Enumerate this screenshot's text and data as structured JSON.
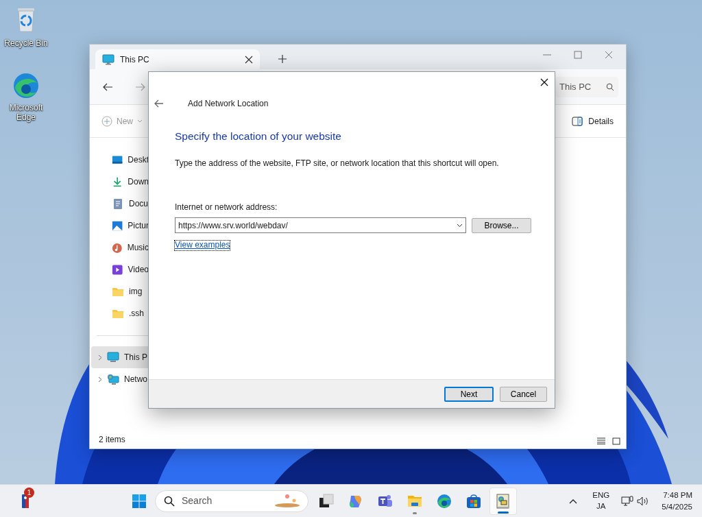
{
  "desktop_icons": [
    {
      "kind": "recycle",
      "label": "Recycle Bin"
    },
    {
      "kind": "edge",
      "label": "Microsoft Edge"
    }
  ],
  "explorer": {
    "tab_title": "This PC",
    "search_text": "This PC",
    "new_label": "New",
    "details_label": "Details",
    "quick_access": [
      {
        "kind": "desktop",
        "label": "Deskt"
      },
      {
        "kind": "download",
        "label": "Down"
      },
      {
        "kind": "documents",
        "label": "Docu"
      },
      {
        "kind": "pictures",
        "label": "Pictur"
      },
      {
        "kind": "music",
        "label": "Music"
      },
      {
        "kind": "videos",
        "label": "Video"
      },
      {
        "kind": "folder",
        "label": "img"
      },
      {
        "kind": "folder",
        "label": ".ssh"
      }
    ],
    "tree": [
      {
        "kind": "pc",
        "label": "This P",
        "selected": true
      },
      {
        "kind": "network",
        "label": "Netwo",
        "selected": false
      }
    ],
    "status": "2 items"
  },
  "dialog": {
    "title": "Add Network Location",
    "heading": "Specify the location of your website",
    "description": "Type the address of the website, FTP site, or network location that this shortcut will open.",
    "field_label": "Internet or network address:",
    "address": "https://www.srv.world/webdav/",
    "browse": "Browse...",
    "link": "View examples",
    "buttons": [
      {
        "label": "Next",
        "default": true
      },
      {
        "label": "Cancel",
        "default": false
      }
    ]
  },
  "taskbar": {
    "widget_badge": "1",
    "search_placeholder": "Search",
    "apps": [
      {
        "kind": "taskview",
        "running": false,
        "selected": false
      },
      {
        "kind": "copilot",
        "running": false,
        "selected": false
      },
      {
        "kind": "teams",
        "running": false,
        "selected": false
      },
      {
        "kind": "files",
        "running": true,
        "selected": false
      },
      {
        "kind": "edge",
        "running": false,
        "selected": false
      },
      {
        "kind": "store",
        "running": false,
        "selected": false
      },
      {
        "kind": "netapp",
        "running": true,
        "selected": true
      }
    ],
    "language": "ENG",
    "ime": "JA",
    "time": "7:48 PM",
    "date": "5/4/2025"
  }
}
